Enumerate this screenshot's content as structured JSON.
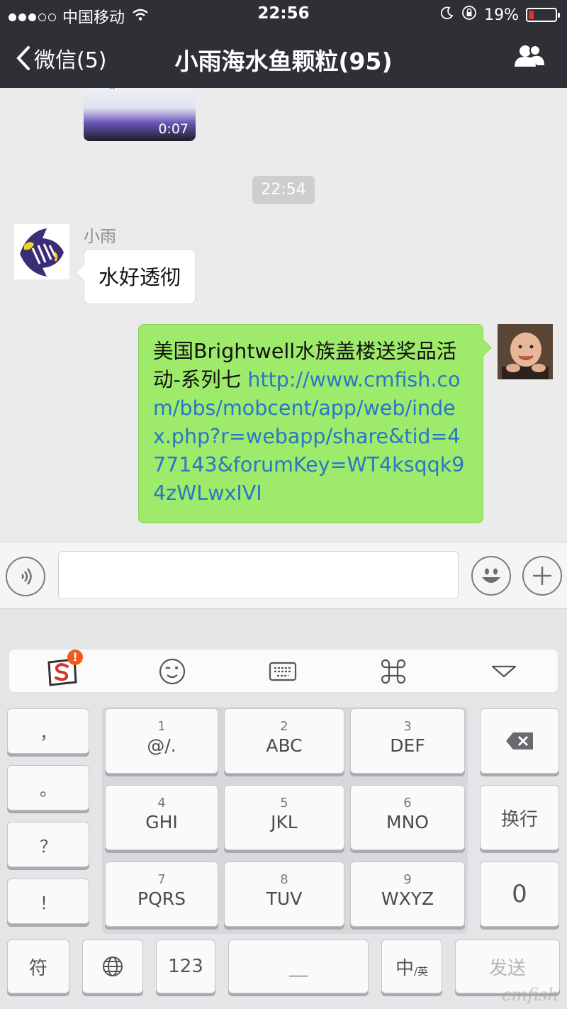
{
  "status_bar": {
    "carrier": "中国移动",
    "time": "22:56",
    "battery": "19%",
    "battery_level": 0.19
  },
  "nav": {
    "back_label": "微信(5)",
    "title": "小雨海水鱼颗粒(95)"
  },
  "chat": {
    "video_duration": "0:07",
    "timestamp": "22:54",
    "messages": [
      {
        "sender": "小雨",
        "text": "水好透彻",
        "direction": "in"
      },
      {
        "direction": "out",
        "text": "美国Brightwell水族盖楼送奖品活动-系列七 ",
        "link": "http://www.cmfish.com/bbs/mobcent/app/web/index.php?r=webapp/share&tid=477143&forumKey=WT4ksqqk94zWLwxIVI"
      }
    ]
  },
  "keyboard": {
    "punct_keys": [
      "，",
      "。",
      "？",
      "！"
    ],
    "keys": [
      {
        "num": "1",
        "letters": "@/."
      },
      {
        "num": "2",
        "letters": "ABC"
      },
      {
        "num": "3",
        "letters": "DEF"
      },
      {
        "num": "4",
        "letters": "GHI"
      },
      {
        "num": "5",
        "letters": "JKL"
      },
      {
        "num": "6",
        "letters": "MNO"
      },
      {
        "num": "7",
        "letters": "PQRS"
      },
      {
        "num": "8",
        "letters": "TUV"
      },
      {
        "num": "9",
        "letters": "WXYZ"
      }
    ],
    "newline": "换行",
    "zero": "0",
    "symbol": "符",
    "num123": "123",
    "space": "＿",
    "lang_main": "中",
    "lang_sub": "/英",
    "send": "发送",
    "badge": "!"
  },
  "watermark": "cmfish"
}
